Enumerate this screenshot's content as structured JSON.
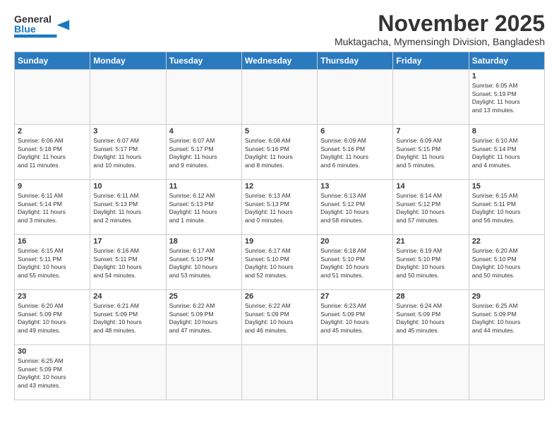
{
  "header": {
    "logo_general": "General",
    "logo_blue": "Blue",
    "title": "November 2025",
    "subtitle": "Muktagacha, Mymensingh Division, Bangladesh"
  },
  "days": [
    "Sunday",
    "Monday",
    "Tuesday",
    "Wednesday",
    "Thursday",
    "Friday",
    "Saturday"
  ],
  "weeks": [
    [
      {
        "date": "",
        "info": ""
      },
      {
        "date": "",
        "info": ""
      },
      {
        "date": "",
        "info": ""
      },
      {
        "date": "",
        "info": ""
      },
      {
        "date": "",
        "info": ""
      },
      {
        "date": "",
        "info": ""
      },
      {
        "date": "1",
        "info": "Sunrise: 6:05 AM\nSunset: 5:19 PM\nDaylight: 11 hours\nand 13 minutes."
      }
    ],
    [
      {
        "date": "2",
        "info": "Sunrise: 6:06 AM\nSunset: 5:18 PM\nDaylight: 11 hours\nand 11 minutes."
      },
      {
        "date": "3",
        "info": "Sunrise: 6:07 AM\nSunset: 5:17 PM\nDaylight: 11 hours\nand 10 minutes."
      },
      {
        "date": "4",
        "info": "Sunrise: 6:07 AM\nSunset: 5:17 PM\nDaylight: 11 hours\nand 9 minutes."
      },
      {
        "date": "5",
        "info": "Sunrise: 6:08 AM\nSunset: 5:16 PM\nDaylight: 11 hours\nand 8 minutes."
      },
      {
        "date": "6",
        "info": "Sunrise: 6:09 AM\nSunset: 5:16 PM\nDaylight: 11 hours\nand 6 minutes."
      },
      {
        "date": "7",
        "info": "Sunrise: 6:09 AM\nSunset: 5:15 PM\nDaylight: 11 hours\nand 5 minutes."
      },
      {
        "date": "8",
        "info": "Sunrise: 6:10 AM\nSunset: 5:14 PM\nDaylight: 11 hours\nand 4 minutes."
      }
    ],
    [
      {
        "date": "9",
        "info": "Sunrise: 6:11 AM\nSunset: 5:14 PM\nDaylight: 11 hours\nand 3 minutes."
      },
      {
        "date": "10",
        "info": "Sunrise: 6:11 AM\nSunset: 5:13 PM\nDaylight: 11 hours\nand 2 minutes."
      },
      {
        "date": "11",
        "info": "Sunrise: 6:12 AM\nSunset: 5:13 PM\nDaylight: 11 hours\nand 1 minute."
      },
      {
        "date": "12",
        "info": "Sunrise: 6:13 AM\nSunset: 5:13 PM\nDaylight: 11 hours\nand 0 minutes."
      },
      {
        "date": "13",
        "info": "Sunrise: 6:13 AM\nSunset: 5:12 PM\nDaylight: 10 hours\nand 58 minutes."
      },
      {
        "date": "14",
        "info": "Sunrise: 6:14 AM\nSunset: 5:12 PM\nDaylight: 10 hours\nand 57 minutes."
      },
      {
        "date": "15",
        "info": "Sunrise: 6:15 AM\nSunset: 5:11 PM\nDaylight: 10 hours\nand 56 minutes."
      }
    ],
    [
      {
        "date": "16",
        "info": "Sunrise: 6:15 AM\nSunset: 5:11 PM\nDaylight: 10 hours\nand 55 minutes."
      },
      {
        "date": "17",
        "info": "Sunrise: 6:16 AM\nSunset: 5:11 PM\nDaylight: 10 hours\nand 54 minutes."
      },
      {
        "date": "18",
        "info": "Sunrise: 6:17 AM\nSunset: 5:10 PM\nDaylight: 10 hours\nand 53 minutes."
      },
      {
        "date": "19",
        "info": "Sunrise: 6:17 AM\nSunset: 5:10 PM\nDaylight: 10 hours\nand 52 minutes."
      },
      {
        "date": "20",
        "info": "Sunrise: 6:18 AM\nSunset: 5:10 PM\nDaylight: 10 hours\nand 51 minutes."
      },
      {
        "date": "21",
        "info": "Sunrise: 6:19 AM\nSunset: 5:10 PM\nDaylight: 10 hours\nand 50 minutes."
      },
      {
        "date": "22",
        "info": "Sunrise: 6:20 AM\nSunset: 5:10 PM\nDaylight: 10 hours\nand 50 minutes."
      }
    ],
    [
      {
        "date": "23",
        "info": "Sunrise: 6:20 AM\nSunset: 5:09 PM\nDaylight: 10 hours\nand 49 minutes."
      },
      {
        "date": "24",
        "info": "Sunrise: 6:21 AM\nSunset: 5:09 PM\nDaylight: 10 hours\nand 48 minutes."
      },
      {
        "date": "25",
        "info": "Sunrise: 6:22 AM\nSunset: 5:09 PM\nDaylight: 10 hours\nand 47 minutes."
      },
      {
        "date": "26",
        "info": "Sunrise: 6:22 AM\nSunset: 5:09 PM\nDaylight: 10 hours\nand 46 minutes."
      },
      {
        "date": "27",
        "info": "Sunrise: 6:23 AM\nSunset: 5:09 PM\nDaylight: 10 hours\nand 45 minutes."
      },
      {
        "date": "28",
        "info": "Sunrise: 6:24 AM\nSunset: 5:09 PM\nDaylight: 10 hours\nand 45 minutes."
      },
      {
        "date": "29",
        "info": "Sunrise: 6:25 AM\nSunset: 5:09 PM\nDaylight: 10 hours\nand 44 minutes."
      }
    ],
    [
      {
        "date": "30",
        "info": "Sunrise: 6:25 AM\nSunset: 5:09 PM\nDaylight: 10 hours\nand 43 minutes."
      },
      {
        "date": "",
        "info": ""
      },
      {
        "date": "",
        "info": ""
      },
      {
        "date": "",
        "info": ""
      },
      {
        "date": "",
        "info": ""
      },
      {
        "date": "",
        "info": ""
      },
      {
        "date": "",
        "info": ""
      }
    ]
  ]
}
